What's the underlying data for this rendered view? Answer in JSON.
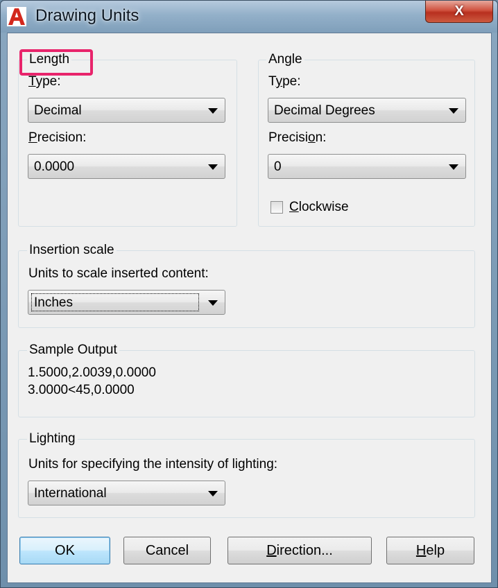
{
  "window": {
    "title": "Drawing Units",
    "close_label": "X",
    "icon": "autocad-a-icon"
  },
  "length": {
    "group_label": "Length",
    "type_label": "Type:",
    "type_value": "Decimal",
    "precision_label": "Precision:",
    "precision_value": "0.0000"
  },
  "angle": {
    "group_label": "Angle",
    "type_label": "Type:",
    "type_value": "Decimal Degrees",
    "precision_label": "Precision:",
    "precision_value": "0",
    "clockwise_label": "Clockwise",
    "clockwise_checked": false
  },
  "insertion_scale": {
    "group_label": "Insertion scale",
    "description": "Units to scale inserted content:",
    "value": "Inches"
  },
  "sample_output": {
    "group_label": "Sample Output",
    "line1": "1.5000,2.0039,0.0000",
    "line2": "3.0000<45,0.0000"
  },
  "lighting": {
    "group_label": "Lighting",
    "description": "Units for specifying the intensity of lighting:",
    "value": "International"
  },
  "buttons": {
    "ok": "OK",
    "cancel": "Cancel",
    "direction": "Direction...",
    "help": "Help"
  },
  "colors": {
    "highlight": "#e8246b",
    "default_button": "#bee6fd"
  }
}
